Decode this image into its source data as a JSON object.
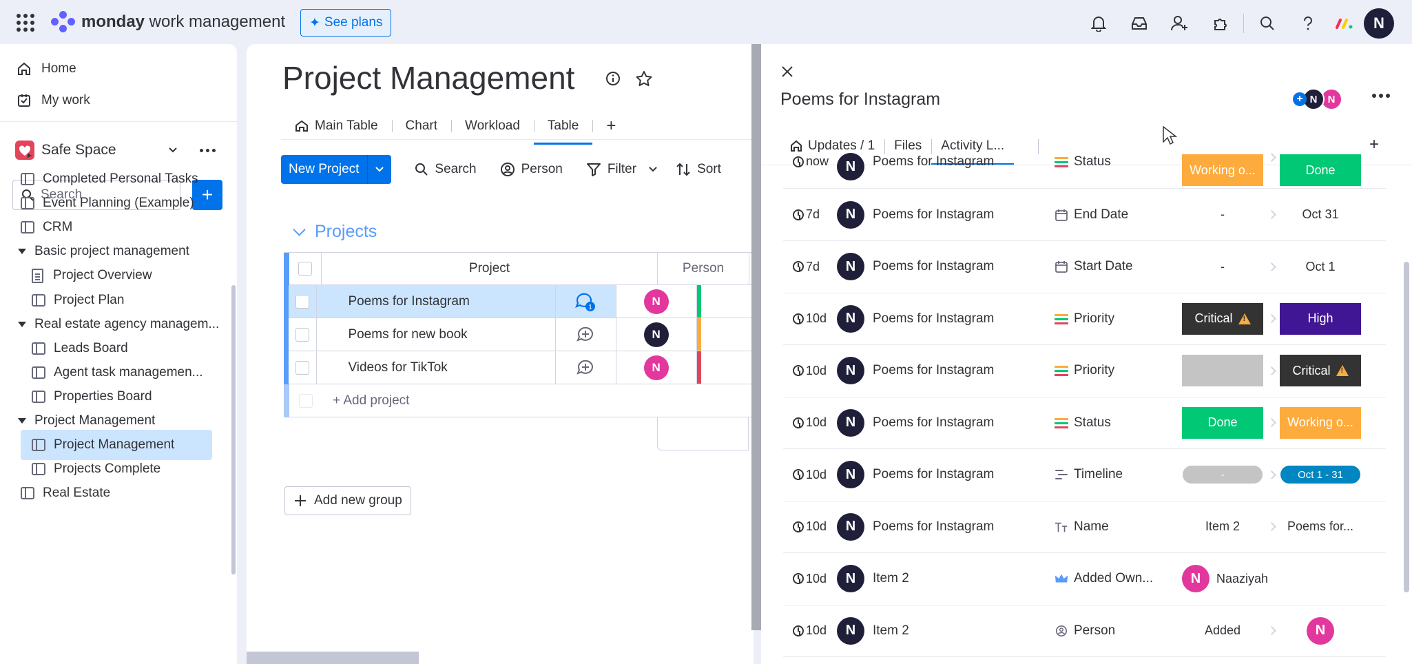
{
  "app": {
    "brand_bold": "monday",
    "brand_rest": " work management",
    "see_plans": "See plans",
    "user_initial": "N",
    "colors": {
      "accent": "#0073ea",
      "done": "#00c875",
      "working": "#fdab3d",
      "critical": "#333333",
      "high": "#401694",
      "avatar_pink": "#e2379d",
      "avatar_dark": "#1f1f3a"
    }
  },
  "sidebar": {
    "home": "Home",
    "my_work": "My work",
    "workspace": "Safe Space",
    "search_placeholder": "Search",
    "items": [
      {
        "label": "Completed Personal Tasks",
        "type": "board",
        "level": 0
      },
      {
        "label": "Event Planning (Example)",
        "type": "board",
        "level": 0
      },
      {
        "label": "CRM",
        "type": "board",
        "level": 0
      },
      {
        "label": "Basic project management",
        "type": "folder",
        "level": 0
      },
      {
        "label": "Project Overview",
        "type": "doc",
        "level": 1
      },
      {
        "label": "Project Plan",
        "type": "board",
        "level": 1
      },
      {
        "label": "Real estate agency managem...",
        "type": "folder",
        "level": 0
      },
      {
        "label": "Leads Board",
        "type": "board",
        "level": 1
      },
      {
        "label": "Agent task managemen...",
        "type": "board",
        "level": 1
      },
      {
        "label": "Properties Board",
        "type": "board",
        "level": 1
      },
      {
        "label": "Project Management",
        "type": "folder",
        "level": 0
      },
      {
        "label": "Project Management",
        "type": "board",
        "level": 1,
        "selected": true
      },
      {
        "label": "Projects Complete",
        "type": "board",
        "level": 1
      },
      {
        "label": "Real Estate",
        "type": "board",
        "level": 0
      }
    ]
  },
  "board": {
    "title": "Project Management",
    "views": [
      "Main Table",
      "Chart",
      "Workload",
      "Table"
    ],
    "active_view": "Table",
    "new_button": "New Project",
    "tools": [
      "Search",
      "Person",
      "Filter",
      "Sort"
    ],
    "group": "Projects",
    "columns": {
      "project": "Project",
      "person": "Person"
    },
    "rows": [
      {
        "name": "Poems for Instagram",
        "updates": "1",
        "person": "N",
        "person_color": "#e2379d",
        "status_color": "#00c875",
        "selected": true
      },
      {
        "name": "Poems for new book",
        "updates": "",
        "person": "N",
        "person_color": "#1f1f3a",
        "status_color": "#fdab3d"
      },
      {
        "name": "Videos for TikTok",
        "updates": "",
        "person": "N",
        "person_color": "#e2379d",
        "status_color": "#e2445c"
      }
    ],
    "add_row": "+ Add project",
    "add_group": "Add new group"
  },
  "panel": {
    "title": "Poems for Instagram",
    "tabs": [
      "Updates / 1",
      "Files",
      "Activity L..."
    ],
    "active_tab": "Activity L...",
    "activity": [
      {
        "time": "now",
        "item": "Poems for Instagram",
        "column": "Status",
        "icon": "status",
        "old": "Working o...",
        "old_style": "working",
        "new": "Done",
        "new_style": "done"
      },
      {
        "time": "7d",
        "item": "Poems for Instagram",
        "column": "End Date",
        "icon": "date",
        "old": "-",
        "old_style": "text",
        "new": "Oct 31",
        "new_style": "text"
      },
      {
        "time": "7d",
        "item": "Poems for Instagram",
        "column": "Start Date",
        "icon": "date",
        "old": "-",
        "old_style": "text",
        "new": "Oct 1",
        "new_style": "text"
      },
      {
        "time": "10d",
        "item": "Poems for Instagram",
        "column": "Priority",
        "icon": "status",
        "old": "Critical",
        "old_style": "critical",
        "new": "High",
        "new_style": "high"
      },
      {
        "time": "10d",
        "item": "Poems for Instagram",
        "column": "Priority",
        "icon": "status",
        "old": "",
        "old_style": "empty",
        "new": "Critical",
        "new_style": "critical"
      },
      {
        "time": "10d",
        "item": "Poems for Instagram",
        "column": "Status",
        "icon": "status",
        "old": "Done",
        "old_style": "done",
        "new": "Working o...",
        "new_style": "working"
      },
      {
        "time": "10d",
        "item": "Poems for Instagram",
        "column": "Timeline",
        "icon": "timeline",
        "old": "-",
        "old_style": "pill-empty",
        "new": "Oct 1 - 31",
        "new_style": "pill-blue"
      },
      {
        "time": "10d",
        "item": "Poems for Instagram",
        "column": "Name",
        "icon": "name",
        "old": "Item 2",
        "old_style": "text",
        "new": "Poems for...",
        "new_style": "text"
      },
      {
        "time": "10d",
        "item": "Item 2",
        "column": "Added Own...",
        "icon": "owner",
        "old": "Naaziyah",
        "old_style": "owner",
        "new": "",
        "new_style": "none"
      },
      {
        "time": "10d",
        "item": "Item 2",
        "column": "Person",
        "icon": "person",
        "old": "Added",
        "old_style": "text",
        "new": "N",
        "new_style": "avatar"
      }
    ]
  }
}
